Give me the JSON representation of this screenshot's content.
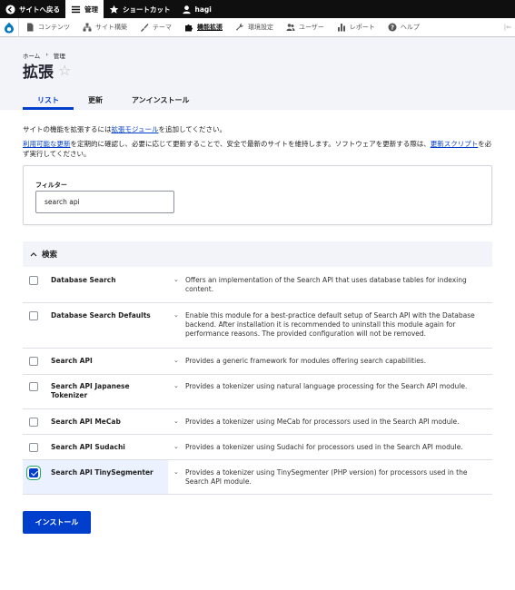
{
  "toolbar": {
    "back": "サイトへ戻る",
    "manage": "管理",
    "shortcuts": "ショートカット",
    "user": "hagi"
  },
  "admin_menu": {
    "items": [
      {
        "label": "コンテンツ",
        "icon": "file-icon"
      },
      {
        "label": "サイト構築",
        "icon": "structure-icon"
      },
      {
        "label": "テーマ",
        "icon": "paint-icon"
      },
      {
        "label": "機能拡張",
        "icon": "puzzle-icon",
        "active": true
      },
      {
        "label": "環境設定",
        "icon": "wrench-icon"
      },
      {
        "label": "ユーザー",
        "icon": "people-icon"
      },
      {
        "label": "レポート",
        "icon": "chart-icon"
      },
      {
        "label": "ヘルプ",
        "icon": "help-icon"
      }
    ]
  },
  "breadcrumb": [
    "ホーム",
    "管理"
  ],
  "breadcrumb_sep": "›",
  "page_title": "拡張",
  "tabs": [
    "リスト",
    "更新",
    "アンインストール"
  ],
  "intro": {
    "line1_link": "拡張モジュール",
    "line1_pre": "サイトの機能を拡張するには",
    "line1_post": "を追加してください。",
    "line2_link": "利用可能な更新",
    "line2_text": "を定期的に確認し、必要に応じて更新することで、安全で最新のサイトを維持します。ソフトウェアを更新する際は、",
    "line2_link2": "更新スクリプト",
    "line2_post": "を必ず実行してください。"
  },
  "filter": {
    "label": "フィルター",
    "value": "search api"
  },
  "section": {
    "title": "検索",
    "caret": "^"
  },
  "modules": [
    {
      "name": "Database Search",
      "desc": "Offers an implementation of the Search API that uses database tables for indexing content.",
      "checked": false
    },
    {
      "name": "Database Search Defaults",
      "desc": "Enable this module for a best-practice default setup of Search API with the Database backend. After installation it is recommended to uninstall this module again for performance reasons. The provided configuration will not be removed.",
      "checked": false
    },
    {
      "name": "Search API",
      "desc": "Provides a generic framework for modules offering search capabilities.",
      "checked": false
    },
    {
      "name": "Search API Japanese Tokenizer",
      "desc": "Provides a tokenizer using natural language processing for the Search API module.",
      "checked": false
    },
    {
      "name": "Search API MeCab",
      "desc": "Provides a tokenizer using MeCab for processors used in the Search API module.",
      "checked": false
    },
    {
      "name": "Search API Sudachi",
      "desc": "Provides a tokenizer using Sudachi for processors used in the Search API module.",
      "checked": false
    },
    {
      "name": "Search API TinySegmenter",
      "desc": "Provides a tokenizer using TinySegmenter (PHP version) for processors used in the Search API module.",
      "checked": true
    }
  ],
  "install_label": "インストール",
  "colors": {
    "accent": "#003ecc",
    "focus": "#26a769",
    "header_bg": "#f3f4f9"
  }
}
